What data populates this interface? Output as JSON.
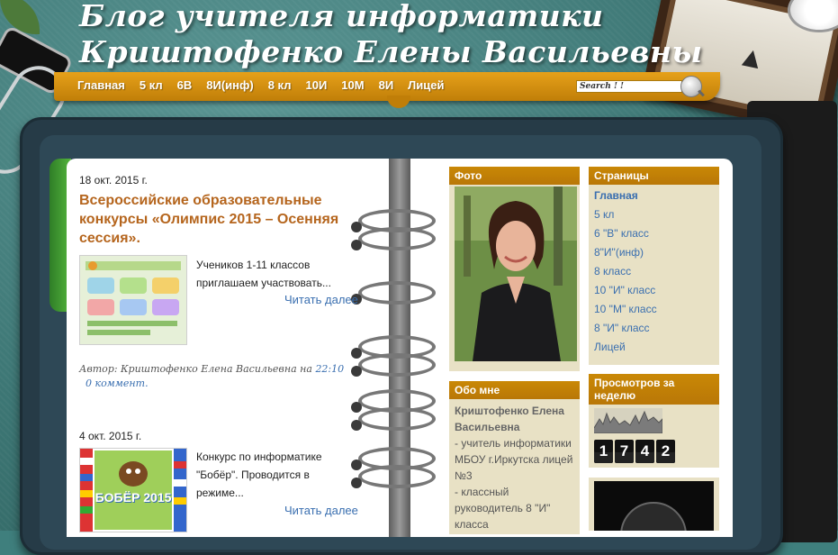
{
  "header": {
    "title_line1": "Блог учителя информатики",
    "title_line2": "Криштофенко Елены Васильевны"
  },
  "nav": {
    "items": [
      "Главная",
      "5 кл",
      "6В",
      "8И(инф)",
      "8 кл",
      "10И",
      "10М",
      "8И",
      "Лицей"
    ]
  },
  "search": {
    "placeholder": "Search ! !"
  },
  "posts": [
    {
      "date": "18 окт. 2015 г.",
      "title": "Всероссийские образовательные конкурсы «Олимпис 2015 – Осенняя сессия».",
      "excerpt": "Учеников 1-11 классов приглашаем участвовать...",
      "read_more": "Читать далее",
      "author_prefix": "Автор: Криштофенко Елена Васильевна на",
      "time": "22:10",
      "comments": "0 коммент."
    },
    {
      "date": "4 окт. 2015 г.",
      "excerpt": "Конкурс по информатике \"Бобёр\". Проводится в режиме...",
      "read_more": "Читать далее",
      "thumb_text": "БОБЁР 2015"
    }
  ],
  "sidebar": {
    "photo": {
      "title": "Фото"
    },
    "about": {
      "title": "Обо мне",
      "name": "Криштофенко Елена Васильевна",
      "lines": [
        "- учитель информатики МБОУ г.Иркутска лицей №3",
        "- классный руководитель 8 \"И\" класса"
      ]
    },
    "pages": {
      "title": "Страницы",
      "items": [
        "Главная",
        "5 кл",
        "6 \"В\" класс",
        "8\"И\"(инф)",
        "8 класс",
        "10 \"И\" класс",
        "10 \"М\" класс",
        "8 \"И\" класс",
        "Лицей"
      ]
    },
    "views": {
      "title": "Просмотров за неделю",
      "digits": [
        "1",
        "7",
        "4",
        "2"
      ]
    }
  },
  "colors": {
    "accent_orange": "#c98806",
    "link_blue": "#3a6fb0",
    "post_title": "#b5651d"
  }
}
